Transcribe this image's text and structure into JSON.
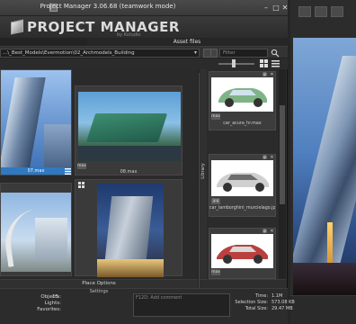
{
  "window": {
    "title": "Project Manager 3.06.68 (teamwork mode)",
    "logo_text": "PROJECT MANAGER",
    "logo_sub": "by Kstudio"
  },
  "tabs": {
    "assets": "Asset files"
  },
  "toolbar": {
    "path": "...\\_Best_Models\\Evermotion\\02_Archmodels_Building",
    "filter_placeholder": "Filter"
  },
  "grid": {
    "items": [
      {
        "caption": "07.max",
        "badge": "max",
        "selected": true
      },
      {
        "caption": "08.max",
        "badge": "max",
        "selected": false
      },
      {
        "caption": "",
        "badge": "",
        "selected": false
      },
      {
        "caption": "",
        "badge": "",
        "selected": false
      }
    ],
    "place_options": "Place Options",
    "settings": "Settings"
  },
  "library": {
    "tab_label": "Library",
    "items": [
      {
        "caption": "car_acura_hr.max",
        "badge": "max"
      },
      {
        "caption": "car_lamborghini_murcielago.jpg",
        "badge": "jpg"
      },
      {
        "caption": "",
        "badge": "max"
      }
    ]
  },
  "status": {
    "objects_label": "Objects:",
    "objects_value": "15",
    "lights_label": "Lights:",
    "lights_value": "",
    "favorites_label": "Favorites:",
    "favorites_value": "",
    "note_placeholder": "F12D: Add comment",
    "time_label": "Time:",
    "time_value": "1.1M",
    "selection_label": "Selection Size:",
    "selection_value": "573.08 KB",
    "total_label": "Total Size:",
    "total_value": "29.47 MB"
  }
}
